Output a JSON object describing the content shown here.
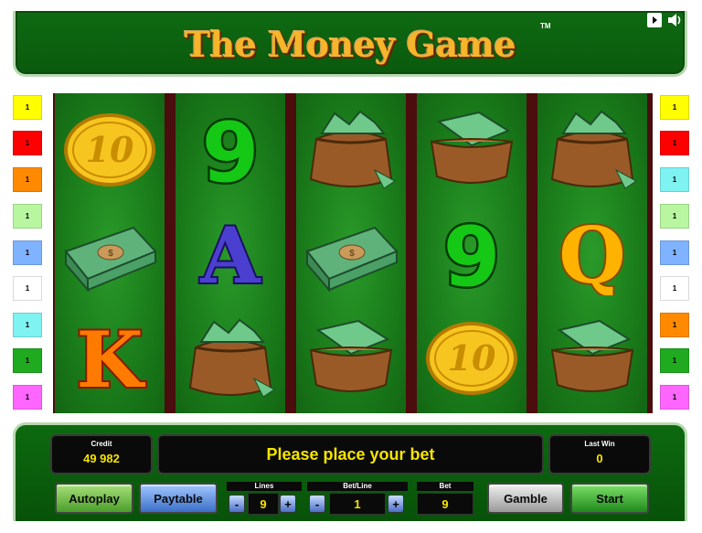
{
  "header": {
    "title": "The Money Game",
    "trademark": "TM"
  },
  "controls": {
    "info_icon": "info-icon",
    "sound_icon": "speaker-icon"
  },
  "reels": [
    [
      "coin-10",
      "bills-stack",
      "letter-K"
    ],
    [
      "number-9",
      "letter-A",
      "money-bag"
    ],
    [
      "money-bag",
      "bills-stack",
      "wallet"
    ],
    [
      "wallet",
      "number-9",
      "coin-10"
    ],
    [
      "money-bag",
      "letter-Q",
      "wallet"
    ]
  ],
  "symbol_text": {
    "coin": "10",
    "nine": "9",
    "A": "A",
    "K": "K",
    "Q": "Q"
  },
  "markers_left": [
    {
      "label": "1",
      "color": "#ffff00"
    },
    {
      "label": "1",
      "color": "#ff0000"
    },
    {
      "label": "1",
      "color": "#ff8a00"
    },
    {
      "label": "1",
      "color": "#b8f7a0"
    },
    {
      "label": "1",
      "color": "#7fb3ff"
    },
    {
      "label": "1",
      "color": "#ffffff"
    },
    {
      "label": "1",
      "color": "#7ff2f2"
    },
    {
      "label": "1",
      "color": "#1faa1f"
    },
    {
      "label": "1",
      "color": "#ff66ff"
    }
  ],
  "markers_right": [
    {
      "label": "1",
      "color": "#ffff00"
    },
    {
      "label": "1",
      "color": "#ff0000"
    },
    {
      "label": "1",
      "color": "#7ff2f2"
    },
    {
      "label": "1",
      "color": "#b8f7a0"
    },
    {
      "label": "1",
      "color": "#7fb3ff"
    },
    {
      "label": "1",
      "color": "#ffffff"
    },
    {
      "label": "1",
      "color": "#ff8a00"
    },
    {
      "label": "1",
      "color": "#1faa1f"
    },
    {
      "label": "1",
      "color": "#ff66ff"
    }
  ],
  "panel": {
    "credit_label": "Credit",
    "credit_value": "49 982",
    "message": "Please place your bet",
    "last_win_label": "Last Win",
    "last_win_value": "0"
  },
  "buttons": {
    "autoplay": "Autoplay",
    "paytable": "Paytable",
    "gamble": "Gamble",
    "start": "Start"
  },
  "bet": {
    "lines_label": "Lines",
    "lines_value": "9",
    "bet_line_label": "Bet/Line",
    "bet_line_value": "1",
    "bet_label": "Bet",
    "bet_value": "9",
    "minus": "-",
    "plus": "+"
  }
}
